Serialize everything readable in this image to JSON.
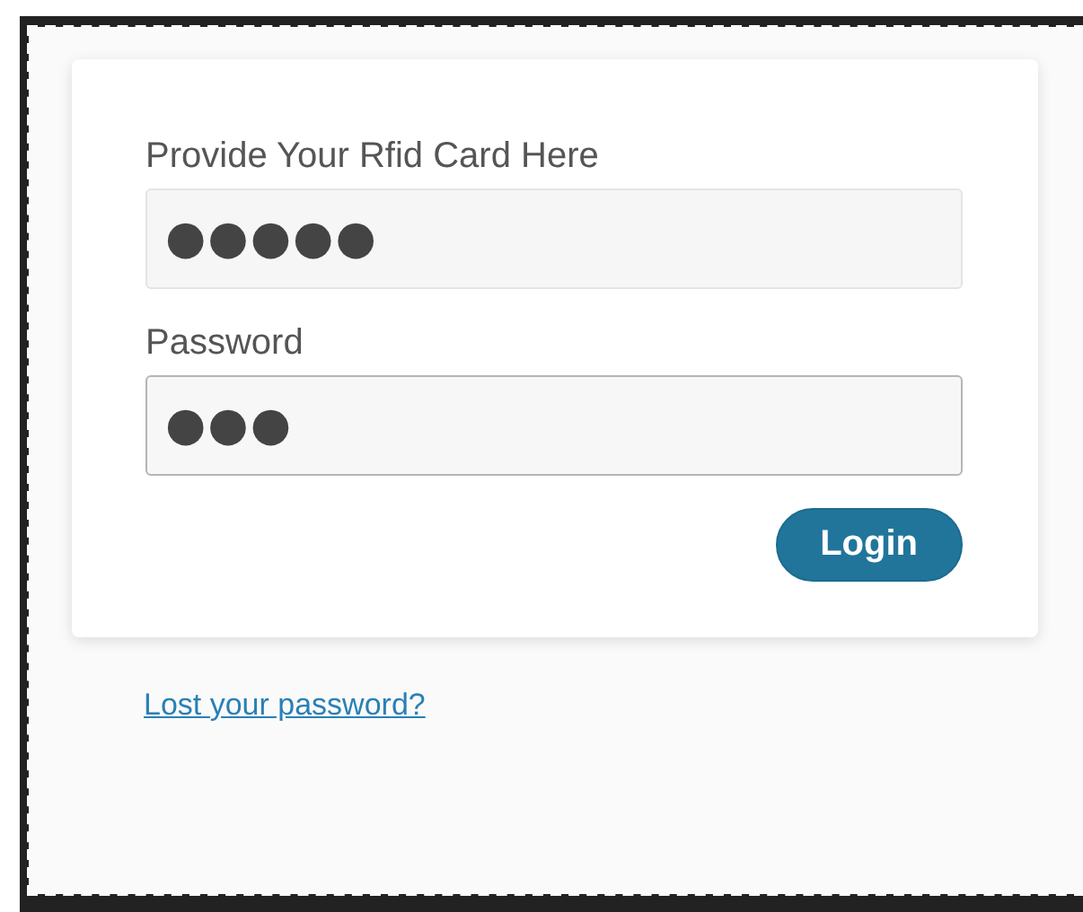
{
  "fields": [
    {
      "label": "Provide Your Rfid Card Here",
      "value": "●●●●●",
      "focused": false
    },
    {
      "label": "Password",
      "value": "●●●",
      "focused": true
    }
  ],
  "login_button": "Login",
  "lost_password_link": "Lost your password?"
}
